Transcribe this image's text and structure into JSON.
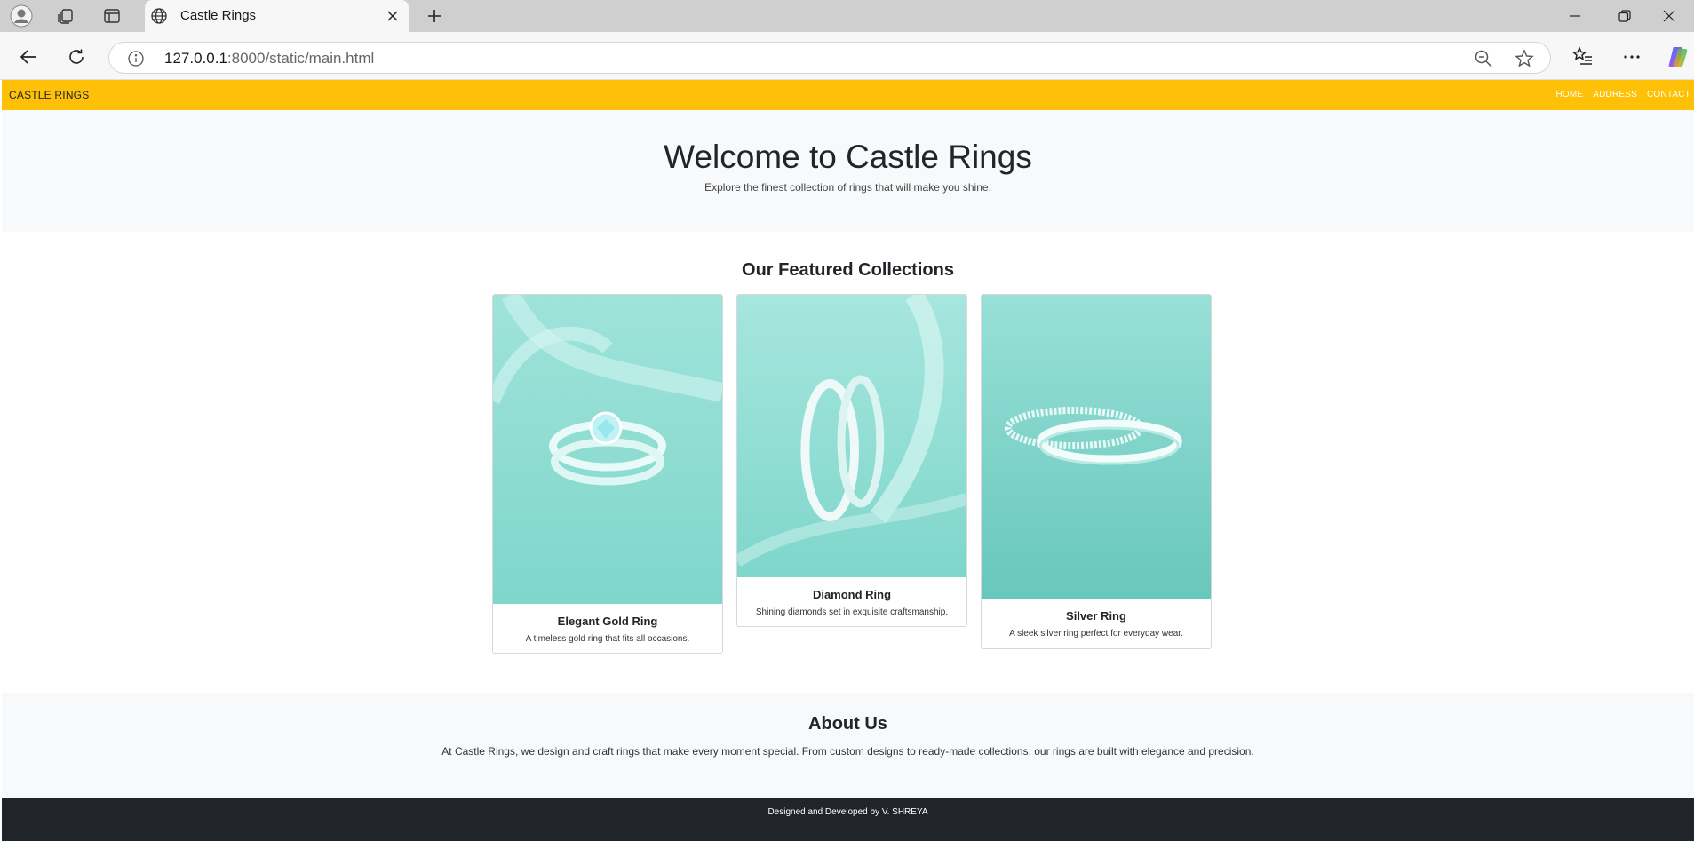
{
  "browser": {
    "tab_title": "Castle Rings",
    "url_host": "127.0.0.1",
    "url_rest": ":8000/static/main.html"
  },
  "site": {
    "brand": "CASTLE RINGS",
    "nav": [
      "HOME",
      "ADDRESS",
      "CONTACT"
    ],
    "hero_title": "Welcome to Castle Rings",
    "hero_subtitle": "Explore the finest collection of rings that will make you shine.",
    "featured_title": "Our Featured Collections",
    "cards": [
      {
        "title": "Elegant Gold Ring",
        "text": "A timeless gold ring that fits all occasions."
      },
      {
        "title": "Diamond Ring",
        "text": "Shining diamonds set in exquisite craftsmanship."
      },
      {
        "title": "Silver Ring",
        "text": "A sleek silver ring perfect for everyday wear."
      }
    ],
    "about_title": "About Us",
    "about_text": "At Castle Rings, we design and craft rings that make every moment special. From custom designs to ready-made collections, our rings are built with elegance and precision.",
    "footer": "Designed and Developed by V. SHREYA"
  },
  "colors": {
    "nav_bg": "#ffc107",
    "hero_bg": "#f8f9fa",
    "footer_bg": "#212529",
    "photo_teal": "#7fd6cb"
  }
}
